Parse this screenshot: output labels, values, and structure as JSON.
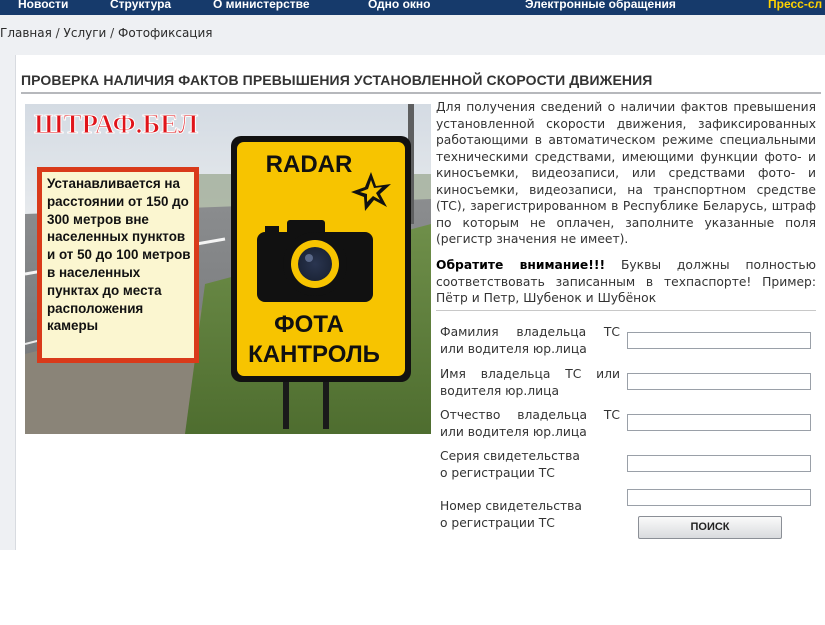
{
  "topnav": {
    "items": [
      {
        "label": "Новости"
      },
      {
        "label": "Структура"
      },
      {
        "label": "О министерстве"
      },
      {
        "label": "Одно окно"
      },
      {
        "label": "Электронные обращения"
      },
      {
        "label": "Пресс-сл"
      }
    ],
    "colors": {
      "background": "#163a6b",
      "text": "#ffffff",
      "press": "#ffd200"
    }
  },
  "breadcrumb": {
    "items": [
      "Главная",
      "Услуги",
      "Фотофиксация"
    ],
    "separator": "/"
  },
  "page": {
    "title": "ПРОВЕРКА НАЛИЧИЯ ФАКТОВ ПРЕВЫШЕНИЯ УСТАНОВЛЕННОЙ СКОРОСТИ ДВИЖЕНИЯ"
  },
  "banner": {
    "brand": "ШТРАФ.БЕЛ",
    "info_text": "Устанавливается на расстоянии от 150 до 300 метров вне населенных пунктов и от 50 до 100 метров в населенных пунктах до места расположения камеры",
    "sign_top": "RADAR",
    "sign_line1": "ФОТА",
    "sign_line2": "КАНТРОЛЬ"
  },
  "description": "Для получения сведений о наличии фактов превышения установленной скорости движения, зафиксированных работающими в автоматическом режиме специальными техническими средствами, имеющими функции фото- и киносъемки, видеозаписи, или средствами фото- и киносъемки, видеозаписи, на транспортном средстве (ТС), зарегистрированном в Республике Беларусь, штраф по которым не оплачен, заполните указанные поля (регистр значения не имеет).",
  "notice": {
    "label": "Обратите внимание!!!",
    "text": "Буквы должны полностью соответствовать записанным в техпаспорте! Пример: Пётр и Петр, Шубенок и Шубёнок"
  },
  "form": {
    "fields": [
      {
        "label": "Фамилия владельца ТС или водителя юр.лица",
        "value": ""
      },
      {
        "label": "Имя владельца ТС или водителя юр.лица",
        "value": ""
      },
      {
        "label": "Отчество владельца ТС или водителя юр.лица",
        "value": ""
      },
      {
        "label": "Серия свидетельства о регистрации ТС",
        "value": ""
      },
      {
        "label": "Номер свидетельства о регистрации ТС",
        "value": ""
      }
    ],
    "submit_label": "ПОИСК"
  }
}
